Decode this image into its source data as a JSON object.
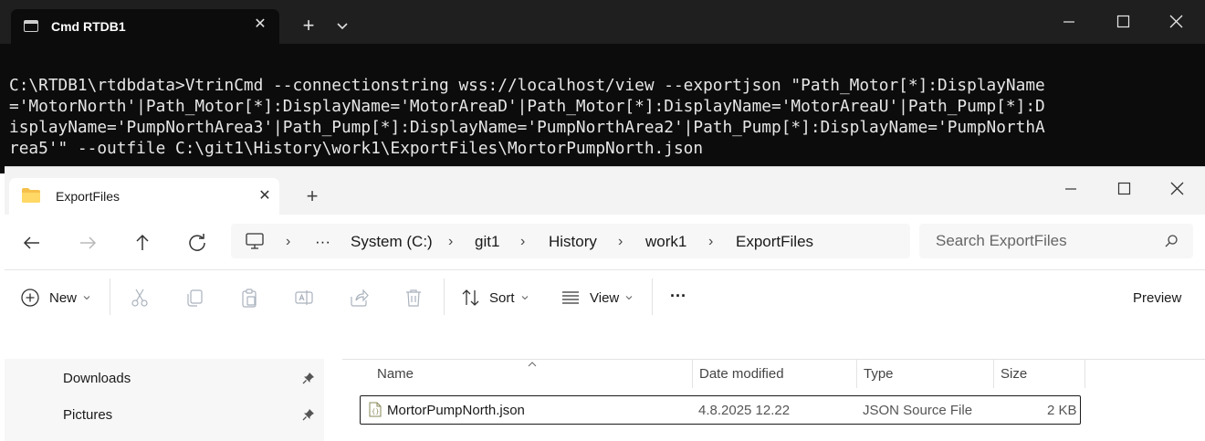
{
  "terminal": {
    "tab_title": "Cmd RTDB1",
    "output_lines": [
      "C:\\RTDB1\\rtdbdata>VtrinCmd --connectionstring wss://localhost/view --exportjson \"Path_Motor[*]:DisplayName",
      "='MotorNorth'|Path_Motor[*]:DisplayName='MotorAreaD'|Path_Motor[*]:DisplayName='MotorAreaU'|Path_Pump[*]:D",
      "isplayName='PumpNorthArea3'|Path_Pump[*]:DisplayName='PumpNorthArea2'|Path_Pump[*]:DisplayName='PumpNorthA",
      "rea5'\" --outfile C:\\git1\\History\\work1\\ExportFiles\\MortorPumpNorth.json"
    ]
  },
  "explorer": {
    "tab_title": "ExportFiles",
    "breadcrumb": {
      "overflow": "···",
      "items": [
        "System (C:)",
        "git1",
        "History",
        "work1",
        "ExportFiles"
      ]
    },
    "search_placeholder": "Search ExportFiles",
    "toolbar": {
      "new_label": "New",
      "sort_label": "Sort",
      "view_label": "View",
      "more_label": "···",
      "preview_label": "Preview"
    },
    "nav_pane": {
      "items": [
        {
          "label": "Downloads",
          "pinned": true
        },
        {
          "label": "Pictures",
          "pinned": true
        }
      ]
    },
    "file_list": {
      "columns": [
        "Name",
        "Date modified",
        "Type",
        "Size"
      ],
      "rows": [
        {
          "name": "MortorPumpNorth.json",
          "date_modified": "4.8.2025 12.22",
          "type": "JSON Source File",
          "size": "2 KB"
        }
      ]
    }
  }
}
